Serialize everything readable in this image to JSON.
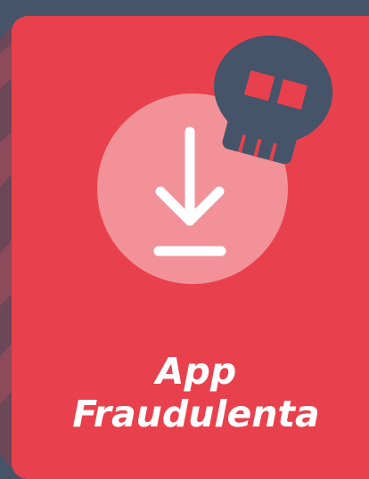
{
  "card": {
    "title_line1": "App",
    "title_line2": "Fraudulenta"
  },
  "icons": {
    "main": "download-icon",
    "badge": "skull-icon"
  },
  "colors": {
    "background": "#455468",
    "card": "#e8414d",
    "download_circle": "#f39198",
    "skull": "#455468",
    "skull_eyes": "#e8414d",
    "text": "#ffffff"
  }
}
